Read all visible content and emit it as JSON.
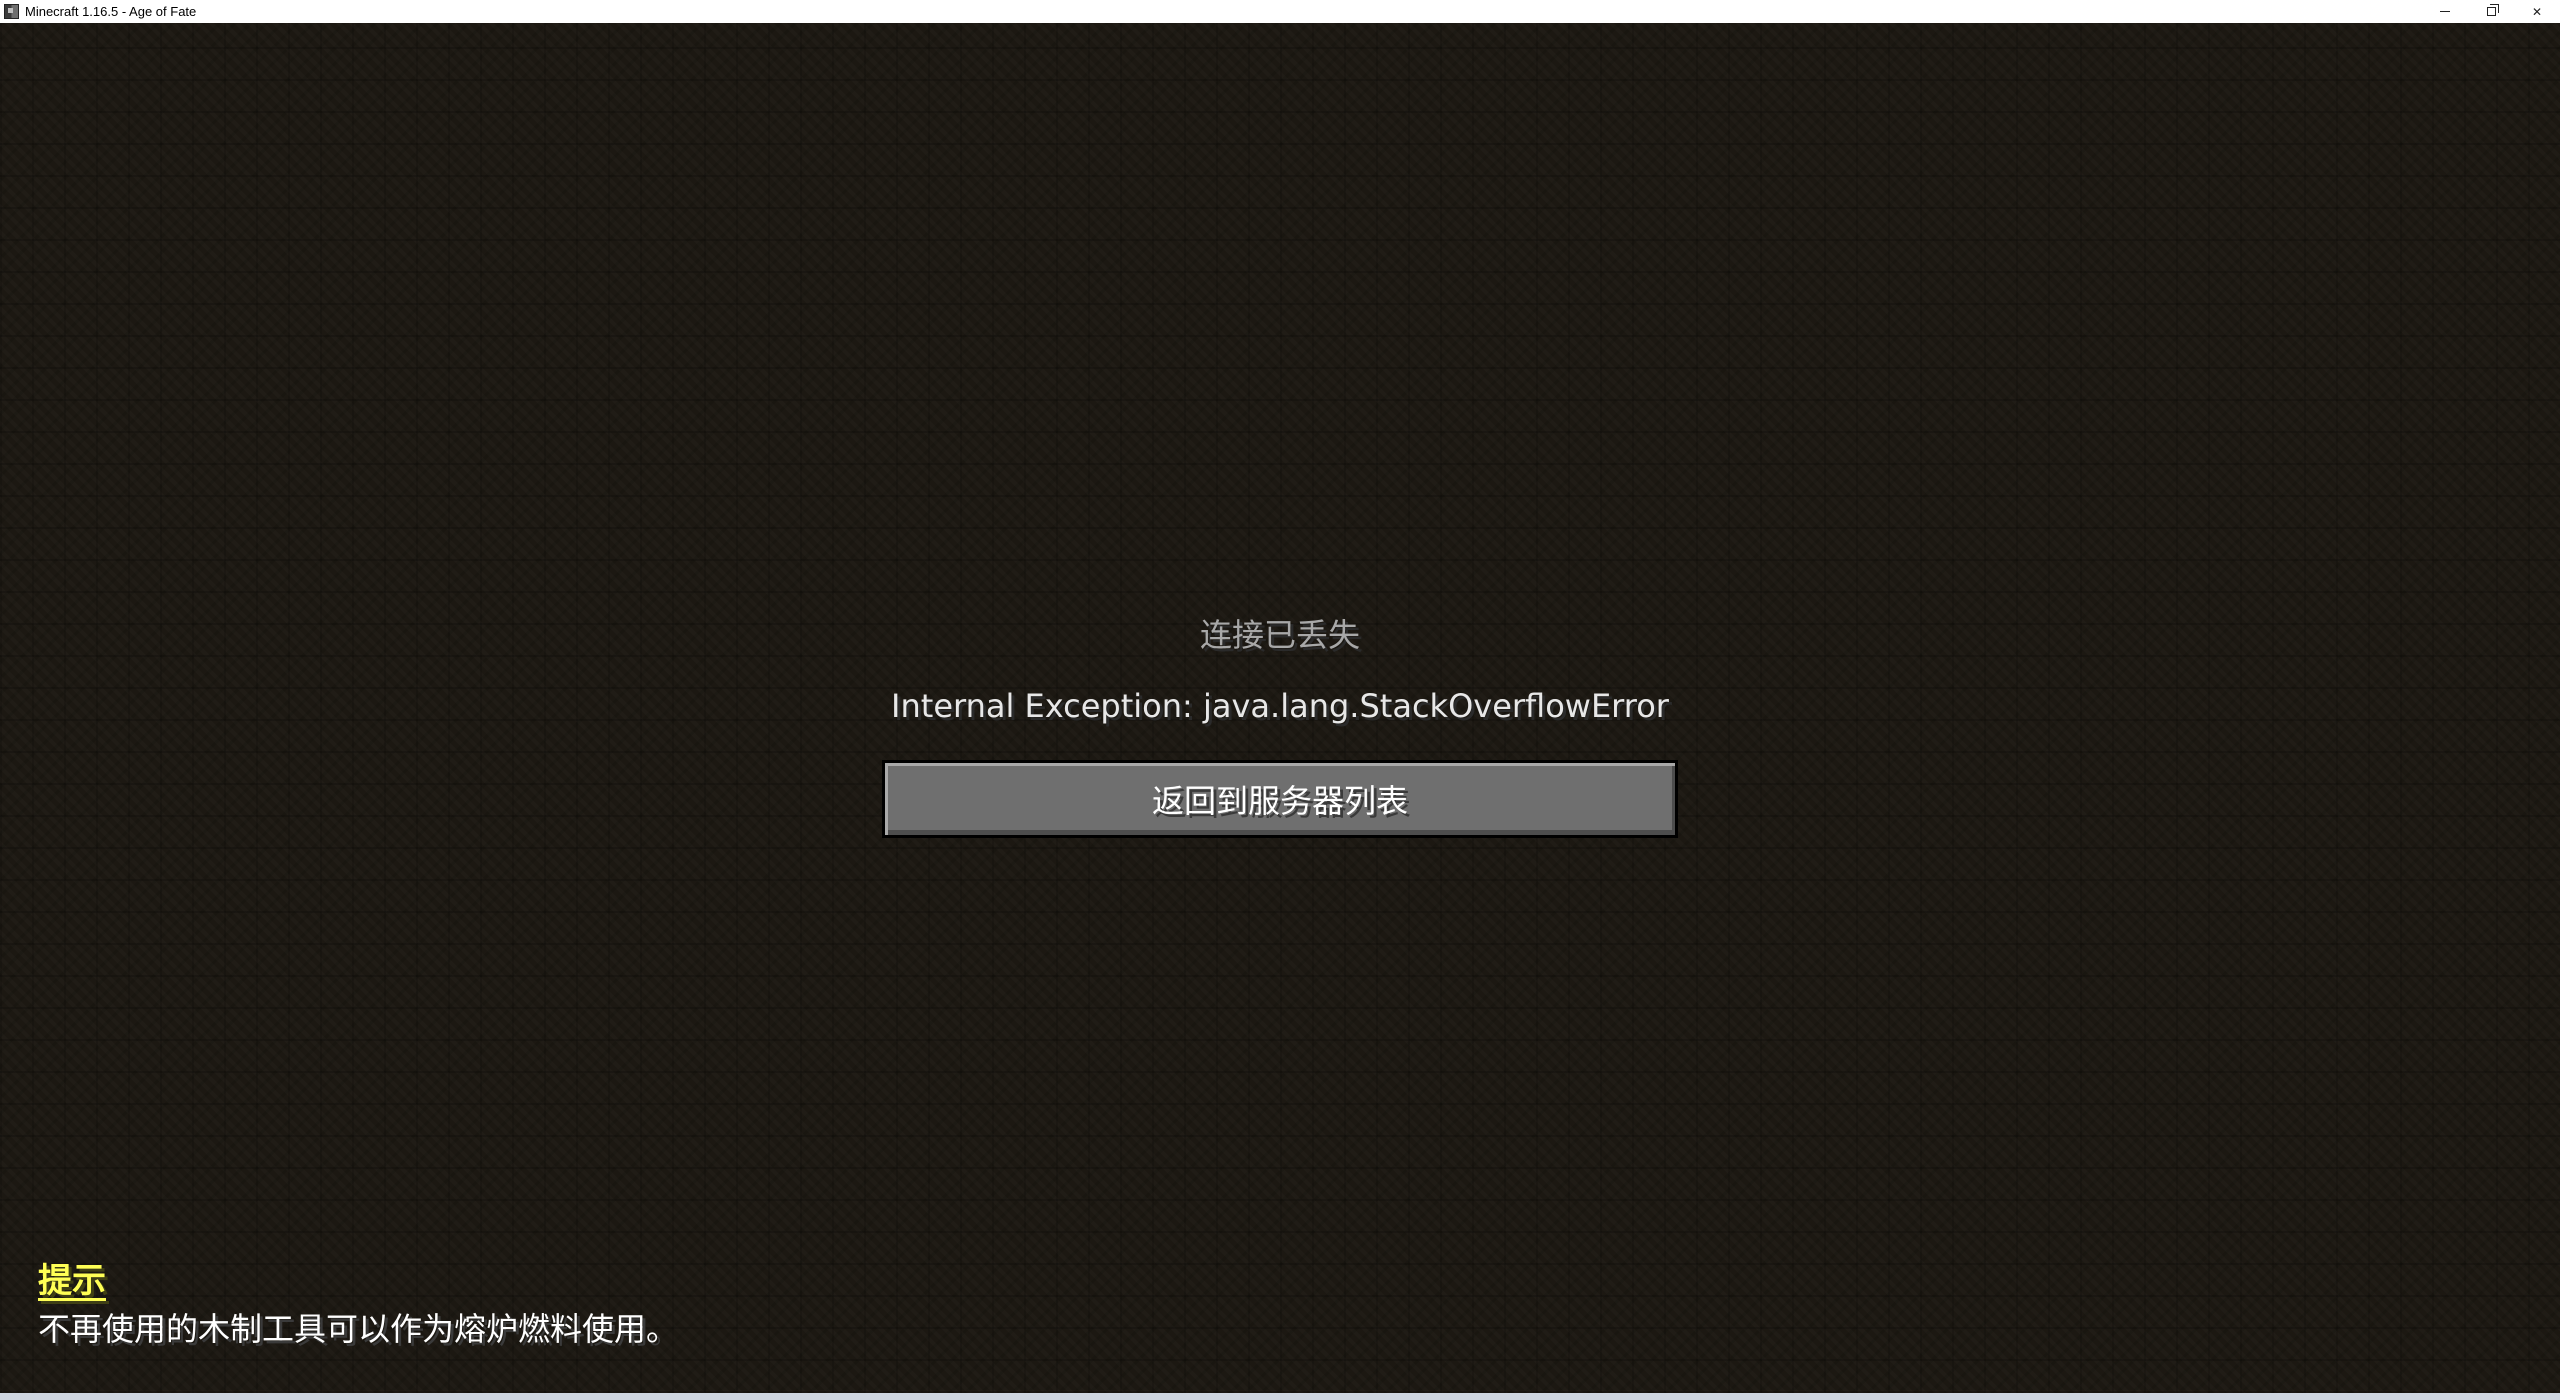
{
  "window": {
    "title": "Minecraft 1.16.5 - Age of Fate",
    "controls": {
      "minimize": "minimize",
      "restore": "restore",
      "close": "✕"
    }
  },
  "screen": {
    "title": "连接已丢失",
    "reason": "Internal Exception: java.lang.StackOverflowError",
    "button_label": "返回到服务器列表"
  },
  "tip": {
    "title": "提示",
    "text": "不再使用的木制工具可以作为熔炉燃料使用。"
  },
  "colors": {
    "tip_title": "#ffff55",
    "title_gray": "#a8a8a8",
    "button_gray": "#6f6f6f"
  }
}
